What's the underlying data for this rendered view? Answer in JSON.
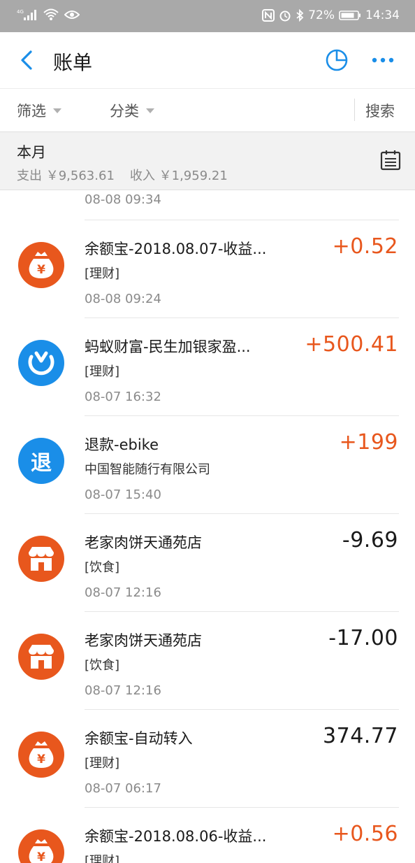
{
  "status_bar": {
    "signal": "4G",
    "battery_percent": "72%",
    "time": "14:34"
  },
  "header": {
    "title": "账单"
  },
  "filter_bar": {
    "filter_label": "筛选",
    "category_label": "分类",
    "search_label": "搜索"
  },
  "month": {
    "title": "本月",
    "expense_label": "支出",
    "expense_value": "￥9,563.61",
    "income_label": "收入",
    "income_value": "￥1,959.21"
  },
  "partial_row": {
    "time": "08-08  09:34"
  },
  "colors": {
    "accent_blue": "#1a8ee8",
    "income_orange": "#e8571d",
    "icon_orange": "#e8571d",
    "icon_blue": "#1a8ee8"
  },
  "transactions": [
    {
      "icon": "money-bag-icon",
      "icon_color": "#e8571d",
      "title": "余额宝-2018.08.07-收益...",
      "sub": "[理财]",
      "time": "08-08  09:24",
      "amount": "+0.52",
      "type": "income"
    },
    {
      "icon": "ant-fortune-icon",
      "icon_color": "#1a8ee8",
      "title": "蚂蚁财富-民生加银家盈...",
      "sub": "[理财]",
      "time": "08-07  16:32",
      "amount": "+500.41",
      "type": "income"
    },
    {
      "icon": "refund-icon",
      "icon_color": "#1a8ee8",
      "icon_text": "退",
      "title": "退款-ebike",
      "sub": "中国智能随行有限公司",
      "time": "08-07  15:40",
      "amount": "+199",
      "type": "income"
    },
    {
      "icon": "shop-icon",
      "icon_color": "#e8571d",
      "title": "老家肉饼天通苑店",
      "sub": "[饮食]",
      "time": "08-07  12:16",
      "amount": "-9.69",
      "type": "expense"
    },
    {
      "icon": "shop-icon",
      "icon_color": "#e8571d",
      "title": "老家肉饼天通苑店",
      "sub": "[饮食]",
      "time": "08-07  12:16",
      "amount": "-17.00",
      "type": "expense"
    },
    {
      "icon": "money-bag-icon",
      "icon_color": "#e8571d",
      "title": "余额宝-自动转入",
      "sub": "[理财]",
      "time": "08-07  06:17",
      "amount": "374.77",
      "type": "expense"
    },
    {
      "icon": "money-bag-icon",
      "icon_color": "#e8571d",
      "title": "余额宝-2018.08.06-收益...",
      "sub": "[理财]",
      "time": "",
      "amount": "+0.56",
      "type": "income"
    }
  ]
}
